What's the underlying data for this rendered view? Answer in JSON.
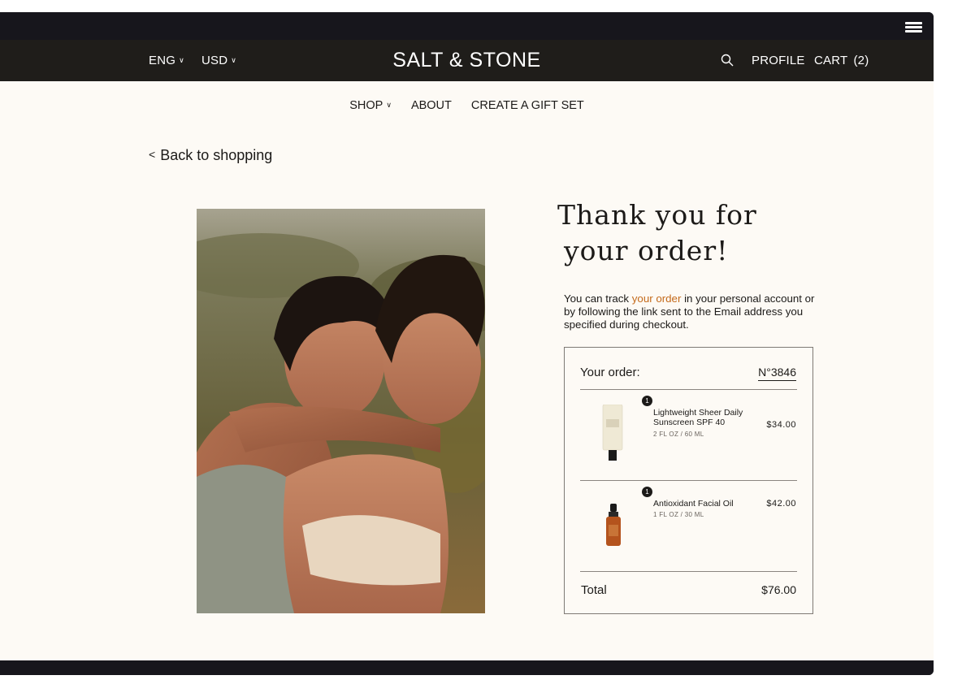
{
  "header": {
    "language": "ENG",
    "currency": "USD",
    "logo": "SALT & STONE",
    "profile": "PROFILE",
    "cart": "CART",
    "cart_count": "(2)"
  },
  "nav": {
    "shop": "SHOP",
    "about": "ABOUT",
    "gift_set": "CREATE A GIFT SET"
  },
  "back_link": "Back to shopping",
  "heading": {
    "line1": "Thank you for",
    "line2": "your order!"
  },
  "info": {
    "text_before": "You can track ",
    "link": "your order",
    "text_after": " in your personal account or by following the link sent to the Email address you specified during checkout."
  },
  "order": {
    "label": "Your order:",
    "number": "N°3846",
    "items": [
      {
        "qty": "1",
        "name": "Lightweight Sheer Daily Sunscreen SPF 40",
        "size": "2 FL OZ / 60 ML",
        "price": "$34.00"
      },
      {
        "qty": "1",
        "name": "Antioxidant Facial Oil",
        "size": "1 FL OZ / 30 ML",
        "price": "$42.00"
      }
    ],
    "total_label": "Total",
    "total_value": "$76.00"
  },
  "colors": {
    "header_bg": "#1f1d1a",
    "page_bg": "#fdfaf5",
    "accent_link": "#c46a1b"
  },
  "icons": [
    "hamburger-menu-icon",
    "search-icon",
    "chevron-down-icon",
    "back-chevron-icon"
  ]
}
